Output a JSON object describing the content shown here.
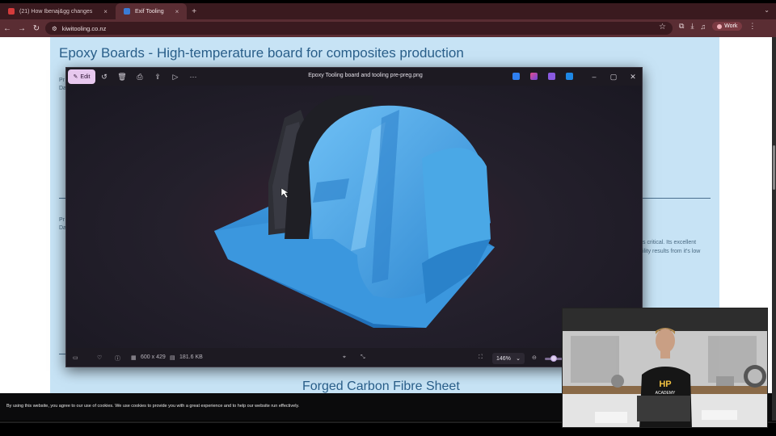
{
  "browser": {
    "tabs": [
      {
        "label": "(21) How Ibenaj&gg changes",
        "close": "×"
      },
      {
        "label": "Exif Tooling",
        "close": "×"
      }
    ],
    "new_tab": "+",
    "url": "kiwitooling.co.nz",
    "profile_label": "Work"
  },
  "page": {
    "heading": "Epoxy Boards - High-temperature board for composites production",
    "snippet_left_1": "Pr",
    "snippet_left_2": "Da",
    "snippet_left_3": "Pr",
    "snippet_left_4": "Da",
    "snippet_right_1": "s critical. Its excellent",
    "snippet_right_2": "ility results from it's low",
    "forged_heading": "Forged Carbon Fibre Sheet"
  },
  "photos_app": {
    "edit_label": "Edit",
    "title": "Epoxy Tooling board and tooling pre-preg.png",
    "dimensions": "600 x 429",
    "file_size": "181.6 KB",
    "zoom": "146%",
    "zoom_level": 0.5
  },
  "cookie": {
    "text": "By using this website, you agree to our use of cookies. We use cookies to provide you with a great experience and to help our website run effectively."
  },
  "webcam": {
    "shirt_top": "HP",
    "shirt_bottom": "ACADEMY"
  },
  "colors": {
    "browser_frame": "#5a2d33",
    "site_background": "#c7e3f5",
    "heading_blue": "#2a5f8a",
    "photos_bg": "#1d1a22",
    "edit_button": "#e7c8ee",
    "part_blue": "#3c9be0"
  }
}
